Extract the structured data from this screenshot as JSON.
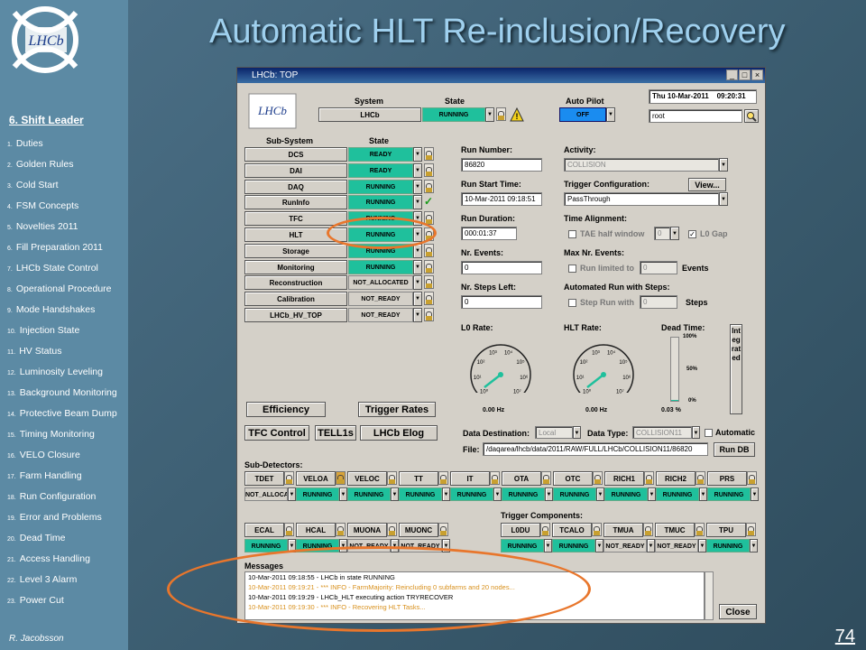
{
  "slide": {
    "title": "Automatic HLT Re-inclusion/Recovery",
    "section": "6. Shift Leader",
    "author": "R. Jacobsson",
    "page": "74",
    "toc": [
      {
        "n": "1.",
        "t": "Duties"
      },
      {
        "n": "2.",
        "t": "Golden Rules"
      },
      {
        "n": "3.",
        "t": "Cold Start"
      },
      {
        "n": "4.",
        "t": "FSM Concepts"
      },
      {
        "n": "5.",
        "t": "Novelties 2011"
      },
      {
        "n": "6.",
        "t": "Fill Preparation 2011"
      },
      {
        "n": "7.",
        "t": "LHCb State Control"
      },
      {
        "n": "8.",
        "t": "Operational Procedure"
      },
      {
        "n": "9.",
        "t": "Mode Handshakes"
      },
      {
        "n": "10.",
        "t": "Injection State"
      },
      {
        "n": "11.",
        "t": "HV Status"
      },
      {
        "n": "12.",
        "t": "Luminosity Leveling"
      },
      {
        "n": "13.",
        "t": "Background Monitoring"
      },
      {
        "n": "14.",
        "t": "Protective Beam Dump"
      },
      {
        "n": "15.",
        "t": "Timing Monitoring"
      },
      {
        "n": "16.",
        "t": "VELO Closure"
      },
      {
        "n": "17.",
        "t": "Farm Handling"
      },
      {
        "n": "18.",
        "t": "Run Configuration"
      },
      {
        "n": "19.",
        "t": "Error and Problems"
      },
      {
        "n": "20.",
        "t": "Dead Time"
      },
      {
        "n": "21.",
        "t": "Access Handling"
      },
      {
        "n": "22.",
        "t": "Level 3 Alarm"
      },
      {
        "n": "23.",
        "t": "Power Cut"
      }
    ]
  },
  "win": {
    "title": "LHCb: TOP",
    "logo": "LHCb",
    "system_label": "System",
    "state_label": "State",
    "system": "LHCb",
    "system_state": "RUNNING",
    "autopilot_label": "Auto Pilot",
    "autopilot": "OFF",
    "datetime": "Thu 10-Mar-2011",
    "time": "09:20:31",
    "user": "root",
    "subsystem_label": "Sub-System",
    "substate_label": "State",
    "subsystems": [
      {
        "name": "DCS",
        "state": "READY",
        "c": "green"
      },
      {
        "name": "DAI",
        "state": "READY",
        "c": "green"
      },
      {
        "name": "DAQ",
        "state": "RUNNING",
        "c": "green"
      },
      {
        "name": "RunInfo",
        "state": "RUNNING",
        "c": "green"
      },
      {
        "name": "TFC",
        "state": "RUNNING",
        "c": "green"
      },
      {
        "name": "HLT",
        "state": "RUNNING",
        "c": "green"
      },
      {
        "name": "Storage",
        "state": "RUNNING",
        "c": "green"
      },
      {
        "name": "Monitoring",
        "state": "RUNNING",
        "c": "green"
      },
      {
        "name": "Reconstruction",
        "state": "NOT_ALLOCATED",
        "c": "grey"
      },
      {
        "name": "Calibration",
        "state": "NOT_READY",
        "c": "grey"
      },
      {
        "name": "LHCb_HV_TOP",
        "state": "NOT_READY",
        "c": "grey"
      }
    ],
    "run_number_label": "Run Number:",
    "run_number": "86820",
    "activity_label": "Activity:",
    "activity": "COLLISION",
    "run_start_label": "Run Start Time:",
    "run_start": "10-Mar-2011 09:18:51",
    "trigger_conf_label": "Trigger Configuration:",
    "trigger_conf": "PassThrough",
    "view_btn": "View...",
    "run_duration_label": "Run Duration:",
    "run_duration": "000:01:37",
    "time_align_label": "Time Alignment:",
    "tae_label": "TAE half window",
    "tae_val": "0",
    "l0gap_label": "L0 Gap",
    "nr_events_label": "Nr. Events:",
    "nr_events": "0",
    "max_events_label": "Max Nr. Events:",
    "run_limited_label": "Run limited to",
    "run_limited_val": "0",
    "events_label": "Events",
    "nr_steps_label": "Nr. Steps Left:",
    "nr_steps": "0",
    "auto_steps_label": "Automated Run with Steps:",
    "step_run_label": "Step Run with",
    "step_run_val": "0",
    "steps_label": "Steps",
    "l0rate_label": "L0 Rate:",
    "l0rate": "0.00 Hz",
    "hltrate_label": "HLT Rate:",
    "hltrate": "0.00 Hz",
    "deadtime_label": "Dead Time:",
    "deadtime": "0.03 %",
    "dt_ticks": [
      "100%",
      "50%",
      "0%"
    ],
    "integrated": "Integrated",
    "gauge_ticks": [
      "10⁰",
      "10¹",
      "10²",
      "10³",
      "10⁴",
      "10⁵",
      "10⁶",
      "10⁷"
    ],
    "efficiency_btn": "Efficiency",
    "trigger_rates_btn": "Trigger Rates",
    "tfc_btn": "TFC Control",
    "tell1s_btn": "TELL1s",
    "elog_btn": "LHCb Elog",
    "data_dest_label": "Data Destination:",
    "data_dest": "Local",
    "data_type_label": "Data Type:",
    "data_type": "COLLISION11",
    "automatic_label": "Automatic",
    "file_label": "File:",
    "file": "/daqarea/lhcb/data/2011/RAW/FULL/LHCb/COLLISION11/86820",
    "rundb_btn": "Run DB",
    "subdet_label": "Sub-Detectors:",
    "subdets1": [
      {
        "name": "TDET",
        "state": "NOT_ALLOCATE",
        "c": "grey"
      },
      {
        "name": "VELOA",
        "state": "RUNNING",
        "c": "green"
      },
      {
        "name": "VELOC",
        "state": "RUNNING",
        "c": "green"
      },
      {
        "name": "TT",
        "state": "RUNNING",
        "c": "green"
      },
      {
        "name": "IT",
        "state": "RUNNING",
        "c": "green"
      },
      {
        "name": "OTA",
        "state": "RUNNING",
        "c": "green"
      },
      {
        "name": "OTC",
        "state": "RUNNING",
        "c": "green"
      },
      {
        "name": "RICH1",
        "state": "RUNNING",
        "c": "green"
      },
      {
        "name": "RICH2",
        "state": "RUNNING",
        "c": "green"
      },
      {
        "name": "PRS",
        "state": "RUNNING",
        "c": "green"
      }
    ],
    "subdets2": [
      {
        "name": "ECAL",
        "state": "RUNNING",
        "c": "green"
      },
      {
        "name": "HCAL",
        "state": "RUNNING",
        "c": "green"
      },
      {
        "name": "MUONA",
        "state": "NOT_READY",
        "c": "grey"
      },
      {
        "name": "MUONC",
        "state": "NOT_READY",
        "c": "grey"
      }
    ],
    "trig_comp_label": "Trigger Components:",
    "trigcomps": [
      {
        "name": "L0DU",
        "state": "RUNNING",
        "c": "green"
      },
      {
        "name": "TCALO",
        "state": "RUNNING",
        "c": "green"
      },
      {
        "name": "TMUA",
        "state": "NOT_READY",
        "c": "grey"
      },
      {
        "name": "TMUC",
        "state": "NOT_READY",
        "c": "grey"
      },
      {
        "name": "TPU",
        "state": "RUNNING",
        "c": "green"
      }
    ],
    "messages_label": "Messages",
    "messages": [
      {
        "t": "10-Mar-2011 09:18:55 - LHCb in state RUNNING",
        "c": "m-black"
      },
      {
        "t": "10-Mar-2011 09:19:21 - *** INFO - FarmMajority: Reincluding 0 subfarms and 20 nodes...",
        "c": "m-orange"
      },
      {
        "t": "10-Mar-2011 09:19:29 - LHCb_HLT executing action TRYRECOVER",
        "c": "m-black"
      },
      {
        "t": "10-Mar-2011 09:19:30 - *** INFO - Recovering HLT Tasks...",
        "c": "m-orange"
      }
    ],
    "close_btn": "Close"
  },
  "colors": {
    "accent": "#e8762c",
    "running": "#1fc09c",
    "title": "#9fd0ee"
  }
}
